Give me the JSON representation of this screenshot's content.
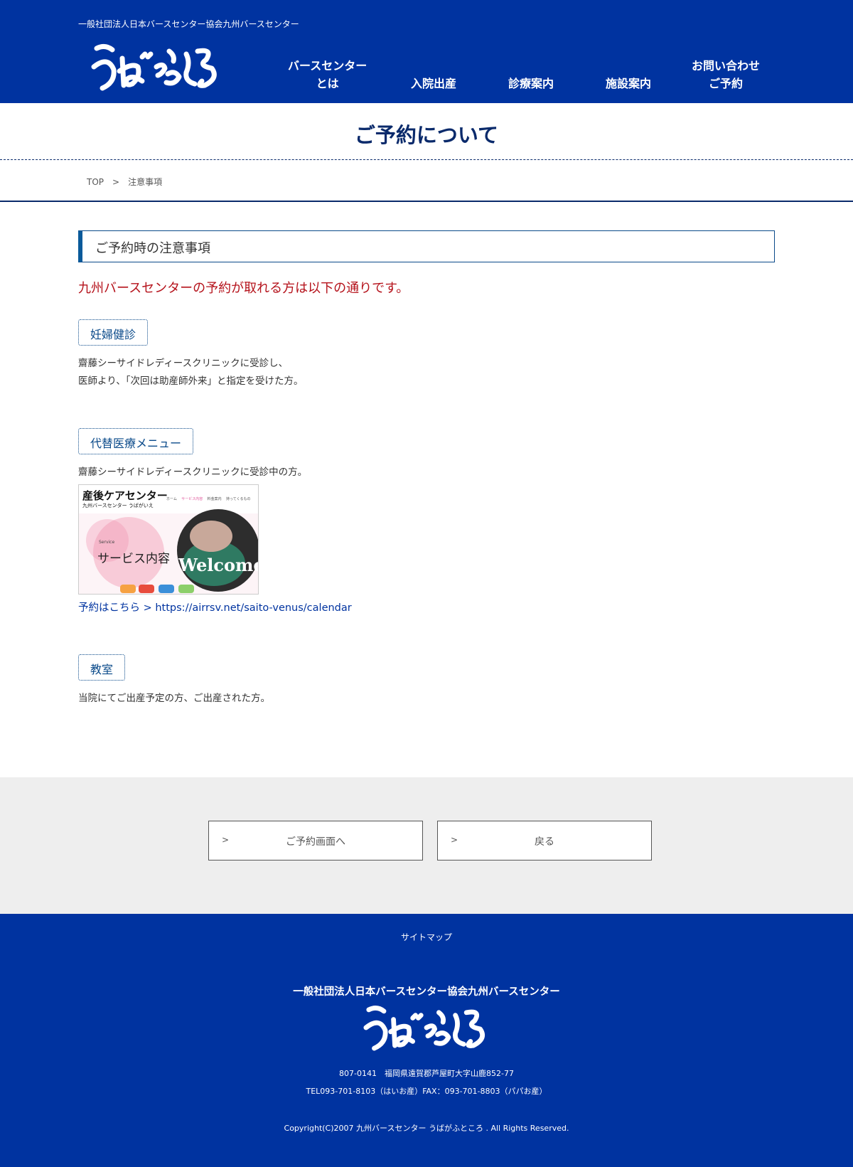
{
  "header": {
    "org_name": "一般社団法人日本バースセンター協会九州バースセンター",
    "logo_text": "うばがふところ",
    "nav": [
      {
        "line1": "バースセンター",
        "line2": "とは"
      },
      {
        "line1": "",
        "line2": "入院出産"
      },
      {
        "line1": "",
        "line2": "診療案内"
      },
      {
        "line1": "",
        "line2": "施設案内"
      },
      {
        "line1": "お問い合わせ",
        "line2": "ご予約"
      }
    ]
  },
  "page_title": "ご予約について",
  "breadcrumb": {
    "home": "TOP",
    "separator": ">",
    "current": "注意事項"
  },
  "main": {
    "section_heading": "ご予約時の注意事項",
    "lead": "九州バースセンターの予約が取れる方は以下の通りです。",
    "blocks": [
      {
        "tag": "妊婦健診",
        "lines": [
          "齋藤シーサイドレディースクリニックに受診し、",
          "医師より、「次回は助産師外来」と指定を受けた方。"
        ]
      },
      {
        "tag": "代替医療メニュー",
        "lines": [
          "齋藤シーサイドレディースクリニックに受診中の方。"
        ],
        "thumbnail": {
          "brand": "産後ケアセンター",
          "brand_sub": "九州バースセンター うばがいえ",
          "menu": [
            "ホーム",
            "サービス内容",
            "料金案内",
            "持ってくるもの"
          ],
          "service_label": "Service",
          "service_title": "サービス内容",
          "welcome": "Welcome"
        },
        "link_text": "予約はこちら > https://airrsv.net/saito-venus/calendar"
      },
      {
        "tag": "教室",
        "lines": [
          "当院にてご出産予定の方、ご出産された方。"
        ]
      }
    ]
  },
  "buttons": [
    {
      "chevron": ">",
      "label": "ご予約画面へ"
    },
    {
      "chevron": ">",
      "label": "戻る"
    }
  ],
  "footer": {
    "sitemap": "サイトマップ",
    "org_name": "一般社団法人日本バースセンター協会九州バースセンター",
    "logo_text": "うばがふところ",
    "address": "807-0141　福岡県遠賀郡芦屋町大字山鹿852-77",
    "tel": "TEL093-701-8103（はいお産）FAX：093-701-8803（パパお産）",
    "copyright": "Copyright(C)2007 九州バースセンター うばがふところ . All Rights Reserved."
  },
  "colors": {
    "brand_blue": "#0033a0",
    "navy": "#0a2a6b",
    "alert_red": "#b5121b",
    "band_gray": "#eeeeee"
  }
}
